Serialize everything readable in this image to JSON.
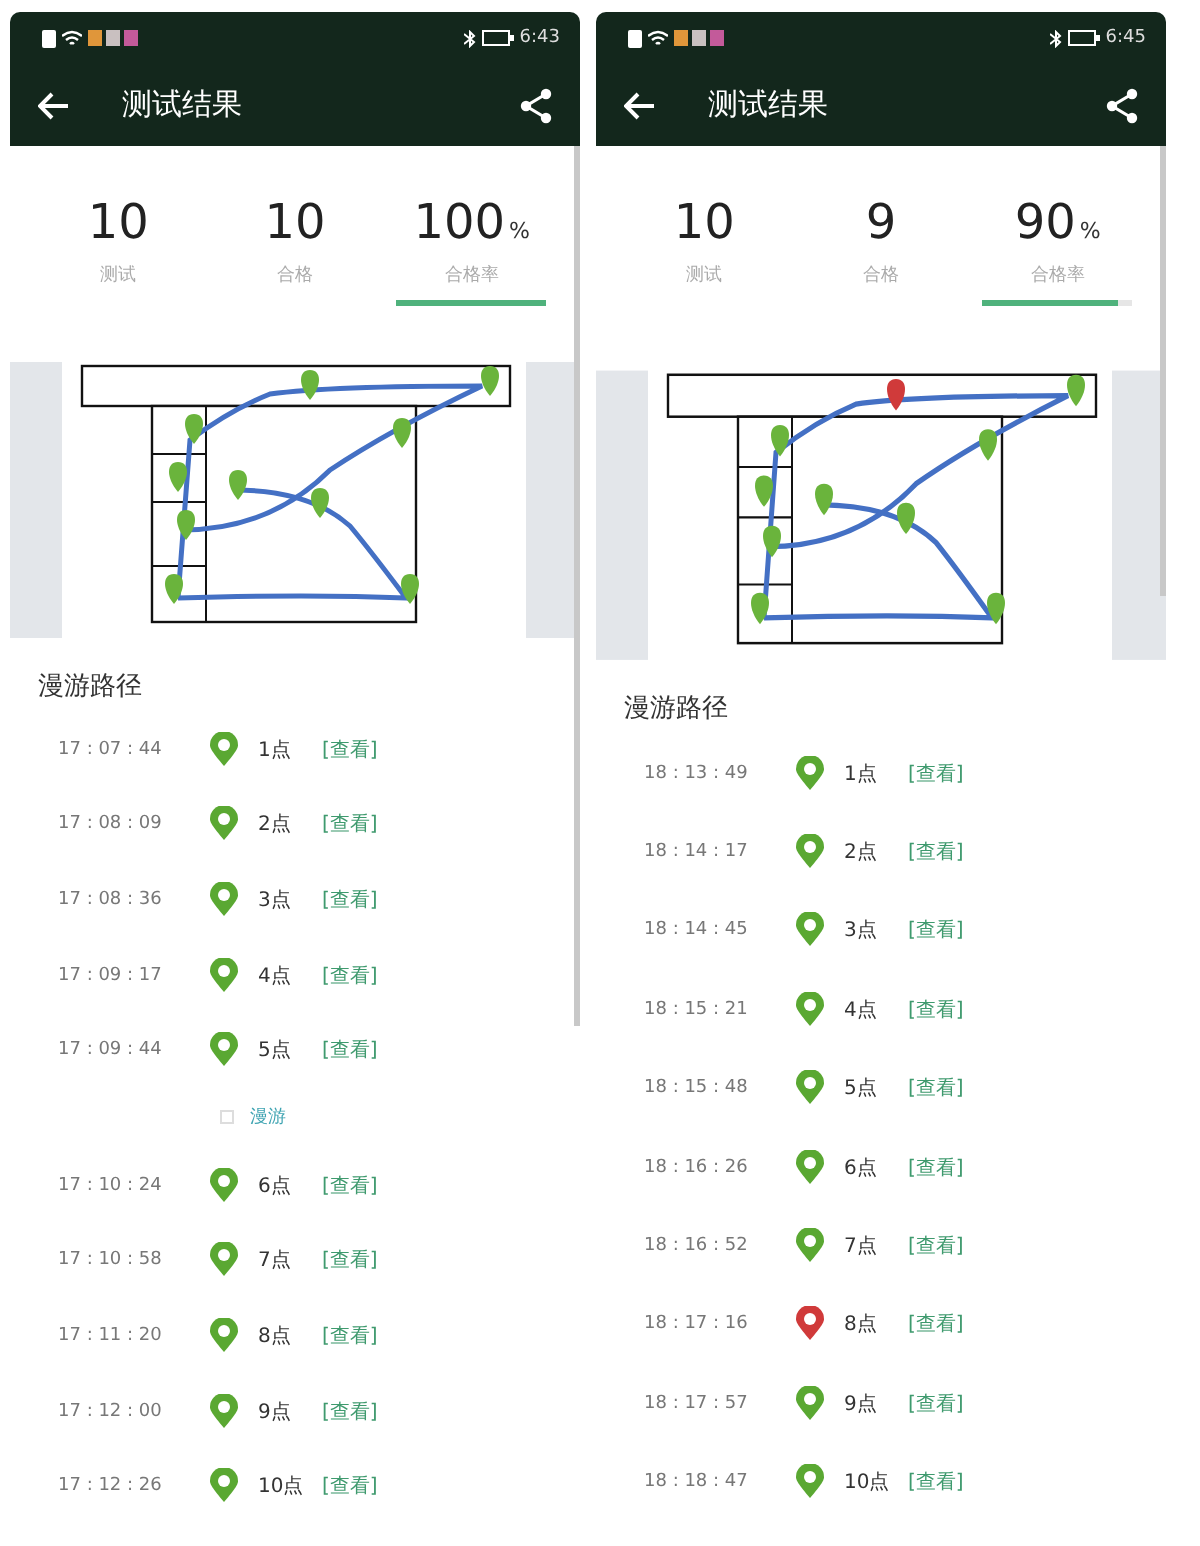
{
  "screens": [
    {
      "status_bar": {
        "time": "6:43"
      },
      "title": "测试结果",
      "stats": [
        {
          "value": "10",
          "label": "测试"
        },
        {
          "value": "10",
          "label": "合格"
        },
        {
          "value": "100",
          "unit": "%",
          "label": "合格率",
          "level": 1.0
        }
      ],
      "route": {
        "title": "漫游路径",
        "items": [
          {
            "kind": "point",
            "time": "17 : 07 : 44",
            "label": "1点",
            "color": "#5aa832",
            "link": "[查看]"
          },
          {
            "kind": "point",
            "time": "17 : 08 : 09",
            "label": "2点",
            "color": "#5aa832",
            "link": "[查看]"
          },
          {
            "kind": "point",
            "time": "17 : 08 : 36",
            "label": "3点",
            "color": "#5aa832",
            "link": "[查看]"
          },
          {
            "kind": "point",
            "time": "17 : 09 : 17",
            "label": "4点",
            "color": "#5aa832",
            "link": "[查看]"
          },
          {
            "kind": "point",
            "time": "17 : 09 : 44",
            "label": "5点",
            "color": "#5aa832",
            "link": "[查看]"
          },
          {
            "kind": "roam",
            "label": "漫游"
          },
          {
            "kind": "point",
            "time": "17 : 10 : 24",
            "label": "6点",
            "color": "#5aa832",
            "link": "[查看]"
          },
          {
            "kind": "point",
            "time": "17 : 10 : 58",
            "label": "7点",
            "color": "#5aa832",
            "link": "[查看]"
          },
          {
            "kind": "point",
            "time": "17 : 11 : 20",
            "label": "8点",
            "color": "#5aa832",
            "link": "[查看]"
          },
          {
            "kind": "point",
            "time": "17 : 12 : 00",
            "label": "9点",
            "color": "#5aa832",
            "link": "[查看]"
          },
          {
            "kind": "point",
            "time": "17 : 12 : 26",
            "label": "10点",
            "color": "#5aa832",
            "link": "[查看]"
          }
        ]
      }
    },
    {
      "status_bar": {
        "time": "6:45"
      },
      "title": "测试结果",
      "stats": [
        {
          "value": "10",
          "label": "测试"
        },
        {
          "value": "9",
          "label": "合格"
        },
        {
          "value": "90",
          "unit": "%",
          "label": "合格率",
          "level": 0.9
        }
      ],
      "route": {
        "title": "漫游路径",
        "items": [
          {
            "kind": "point",
            "time": "18 : 13 : 49",
            "label": "1点",
            "color": "#5aa832",
            "link": "[查看]"
          },
          {
            "kind": "point",
            "time": "18 : 14 : 17",
            "label": "2点",
            "color": "#5aa832",
            "link": "[查看]"
          },
          {
            "kind": "point",
            "time": "18 : 14 : 45",
            "label": "3点",
            "color": "#5aa832",
            "link": "[查看]"
          },
          {
            "kind": "point",
            "time": "18 : 15 : 21",
            "label": "4点",
            "color": "#5aa832",
            "link": "[查看]"
          },
          {
            "kind": "point",
            "time": "18 : 15 : 48",
            "label": "5点",
            "color": "#5aa832",
            "link": "[查看]"
          },
          {
            "kind": "point",
            "time": "18 : 16 : 26",
            "label": "6点",
            "color": "#5aa832",
            "link": "[查看]"
          },
          {
            "kind": "point",
            "time": "18 : 16 : 52",
            "label": "7点",
            "color": "#5aa832",
            "link": "[查看]"
          },
          {
            "kind": "point",
            "time": "18 : 17 : 16",
            "label": "8点",
            "color": "#d03a3a",
            "link": "[查看]"
          },
          {
            "kind": "point",
            "time": "18 : 17 : 57",
            "label": "9点",
            "color": "#5aa832",
            "link": "[查看]"
          },
          {
            "kind": "point",
            "time": "18 : 18 : 47",
            "label": "10点",
            "color": "#5aa832",
            "link": "[查看]"
          }
        ]
      }
    }
  ]
}
